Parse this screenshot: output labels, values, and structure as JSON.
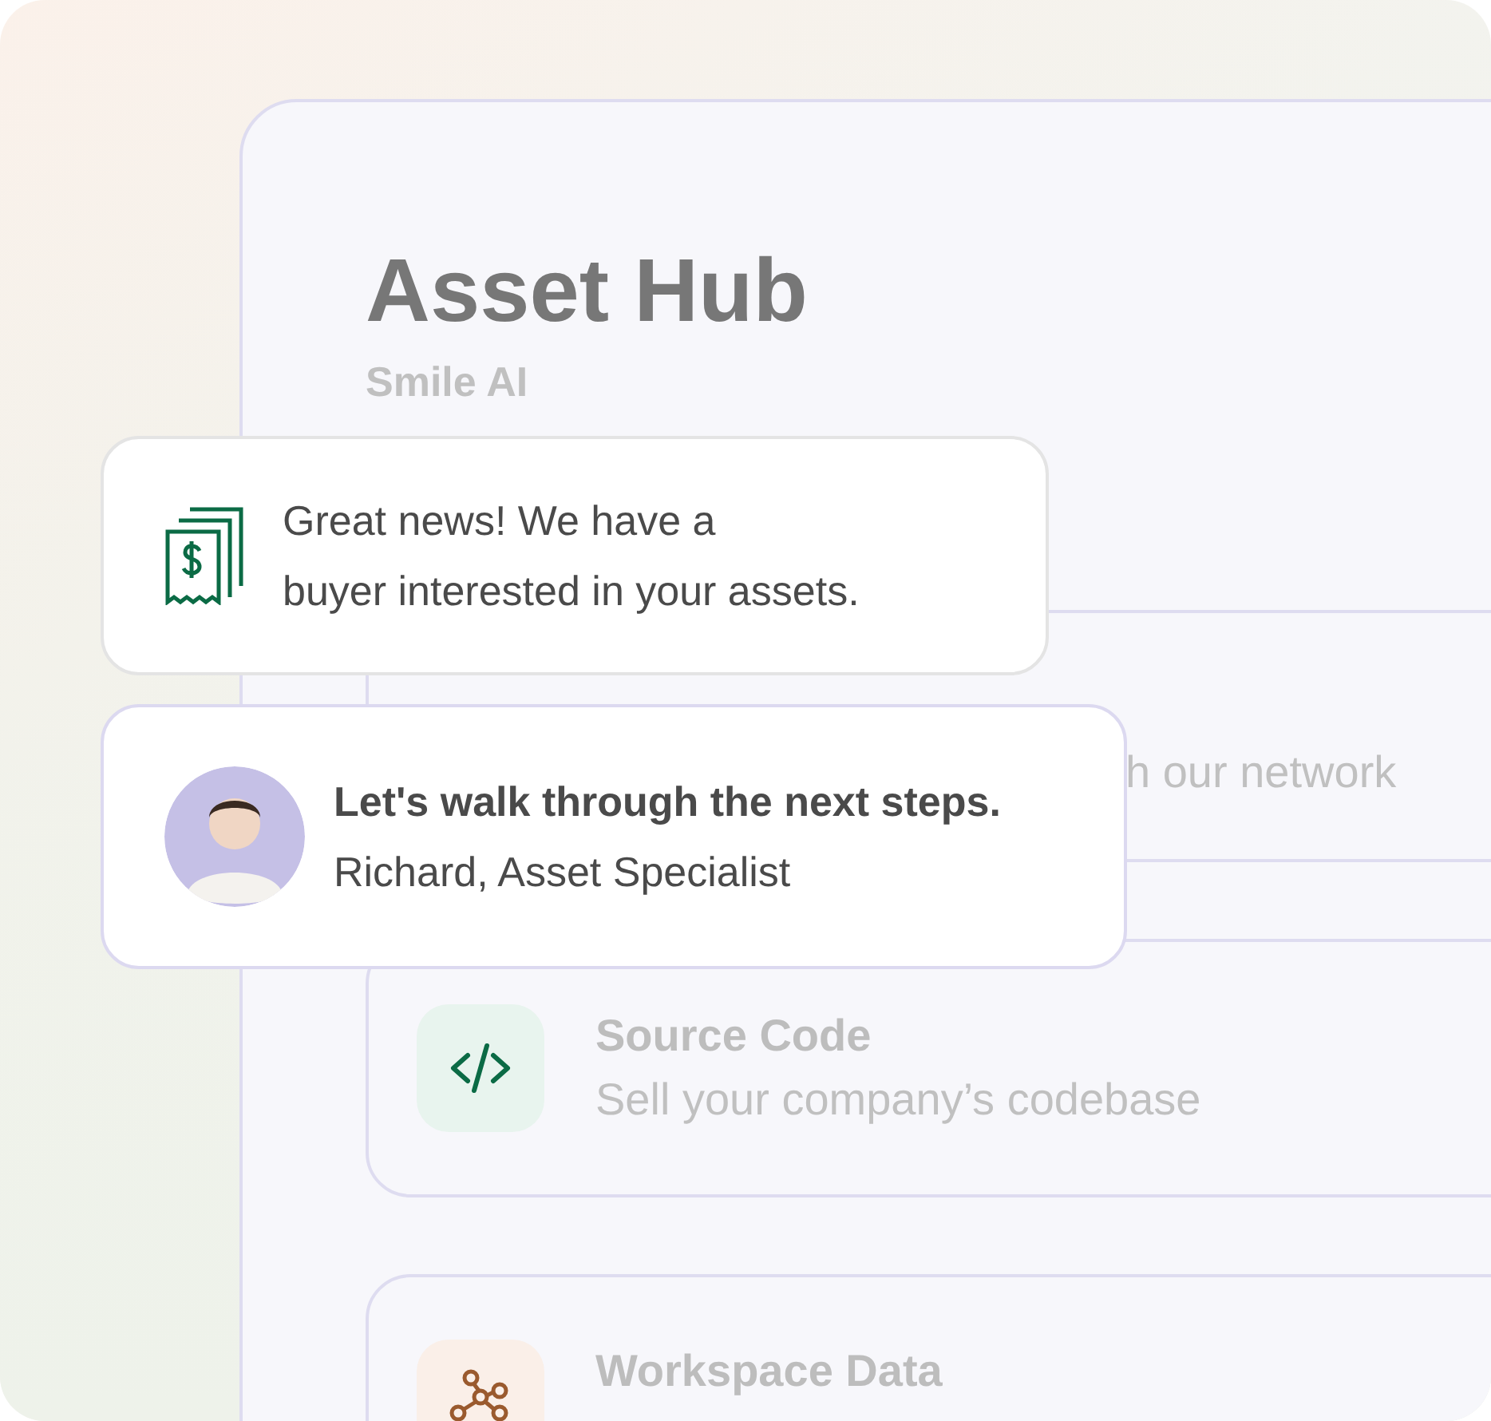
{
  "hub": {
    "title": "Asset Hub",
    "subtitle": "Smile AI"
  },
  "covered_card": {
    "description": "h our network"
  },
  "asset_cards": [
    {
      "kind": "code",
      "title": "Source Code",
      "description": "Sell your company’s codebase"
    },
    {
      "kind": "data",
      "title": "Workspace Data"
    }
  ],
  "notifications": [
    {
      "kind": "payment",
      "lines": [
        "Great news! We have a",
        "buyer interested in your assets."
      ]
    },
    {
      "kind": "message",
      "title": "Let's walk through the next steps.",
      "text": "Richard, Asset Specialist"
    }
  ]
}
